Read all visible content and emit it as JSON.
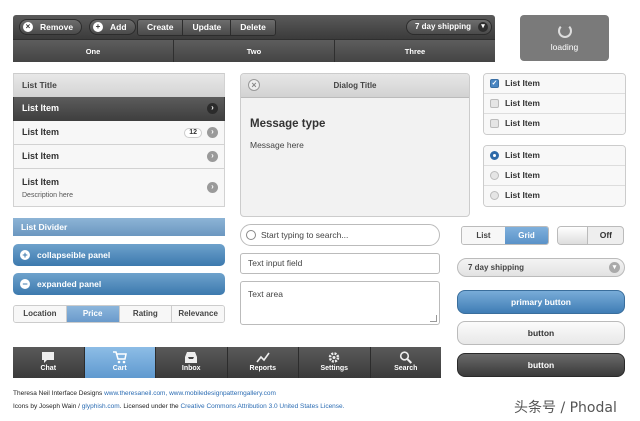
{
  "toolbar": {
    "remove": "Remove",
    "add": "Add",
    "segments": [
      "Create",
      "Update",
      "Delete"
    ],
    "shipping": "7 day shipping"
  },
  "top_tabs": [
    "One",
    "Two",
    "Three"
  ],
  "loading": "loading",
  "list": {
    "title": "List Title",
    "items": [
      {
        "label": "List Item"
      },
      {
        "label": "List Item",
        "badge": "12"
      },
      {
        "label": "List Item"
      },
      {
        "label": "List Item",
        "description": "Description here"
      }
    ]
  },
  "divider": "List Divider",
  "panels": {
    "collapsible": "collapseible panel",
    "expanded": "expanded panel"
  },
  "sort_segments": [
    "Location",
    "Price",
    "Rating",
    "Relevance"
  ],
  "dialog": {
    "title": "Dialog Title",
    "heading": "Message type",
    "body": "Message here"
  },
  "search": {
    "placeholder": "Start typing to search..."
  },
  "text_input": {
    "placeholder": "Text input field"
  },
  "text_area": {
    "placeholder": "Text area"
  },
  "checkboxes": [
    "List Item",
    "List Item",
    "List Item"
  ],
  "radios": [
    "List Item",
    "List Item",
    "List Item"
  ],
  "view_segments": [
    "List",
    "Grid"
  ],
  "toggle": "Off",
  "shipping2": "7 day shipping",
  "buttons": {
    "primary": "primary button",
    "light": "button",
    "dark": "button"
  },
  "tabbar": [
    "Chat",
    "Cart",
    "Inbox",
    "Reports",
    "Settings",
    "Search"
  ],
  "credits": {
    "line1_a": "Theresa Neil Interface Designs",
    "line1_link1": "www.theresaneil.com,",
    "line1_link2": "www.mobiledesignpatterngallery.com",
    "line2_a": "Icons by Joseph Wain /",
    "line2_link1": "glyphish.com",
    "line2_b": ". Licensed under the",
    "line2_link2": "Creative Commons Attribution 3.0 United States License."
  },
  "watermark": "头条号 / Phodal",
  "colors": {
    "accent": "#4a86c2",
    "dark": "#3f3f3f"
  }
}
